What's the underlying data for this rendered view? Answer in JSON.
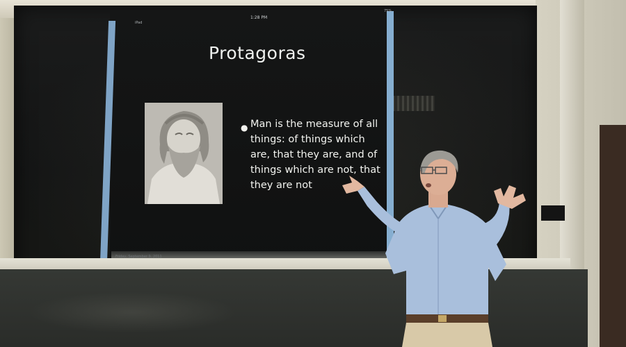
{
  "slide": {
    "title": "Protagoras",
    "bullet": "Man is the measure of all things: of things which are, that they are, and of things which are not, that they are not",
    "status_time": "1:28 PM",
    "status_left": "iPad",
    "status_right": "75%",
    "footer": "Friday, September 9, 2011",
    "image": "bust-of-protagoras"
  },
  "scene": {
    "subject": "lecturer",
    "colors": {
      "slide_background": "#121313",
      "slide_text": "#f2f3ef",
      "screen_edge": "#86aed0",
      "shirt": "#a9bfdc",
      "trousers": "#d8c9a8"
    }
  }
}
